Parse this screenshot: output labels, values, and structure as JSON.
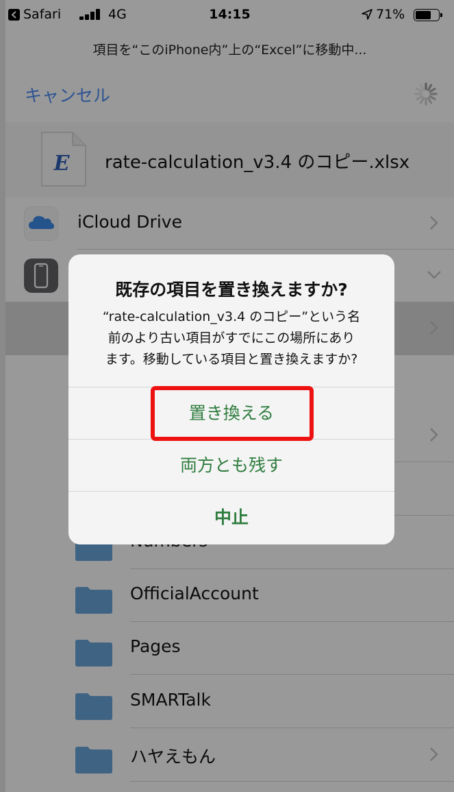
{
  "status_bar": {
    "back_app": "Safari",
    "network": "4G",
    "time": "14:15",
    "battery_percent": "71%",
    "battery_level": 0.71
  },
  "header": {
    "prompt": "項目を“このiPhone内”上の“Excel”に移動中...",
    "cancel_label": "キャンセル"
  },
  "file": {
    "icon_letter": "E",
    "name": "rate-calculation_v3.4 のコピー.xlsx"
  },
  "locations": [
    {
      "label": "iCloud Drive",
      "icon": "icloud-icon",
      "chevron": "right"
    },
    {
      "label": "",
      "icon": "iphone-icon",
      "chevron": "down"
    }
  ],
  "folders": [
    {
      "label": "Numbers",
      "chevron": false
    },
    {
      "label": "OfficialAccount",
      "chevron": false
    },
    {
      "label": "Pages",
      "chevron": false
    },
    {
      "label": "SMARTalk",
      "chevron": false
    },
    {
      "label": "ハヤえもん",
      "chevron": true
    }
  ],
  "alert": {
    "title": "既存の項目を置き換えますか?",
    "message_lines": [
      "“rate-calculation_v3.4 のコピー”という名",
      "前のより古い項目がすでにこの場所にあり",
      "ます。移動している項目と置き換えますか?"
    ],
    "buttons": {
      "replace": "置き換える",
      "keep_both": "両方とも残す",
      "stop": "中止"
    }
  },
  "colors": {
    "accent_blue": "#4c8af3",
    "alert_button_green": "#2f7d3f",
    "highlight_red": "#ee1111",
    "folder_blue": "#6aa6da"
  }
}
